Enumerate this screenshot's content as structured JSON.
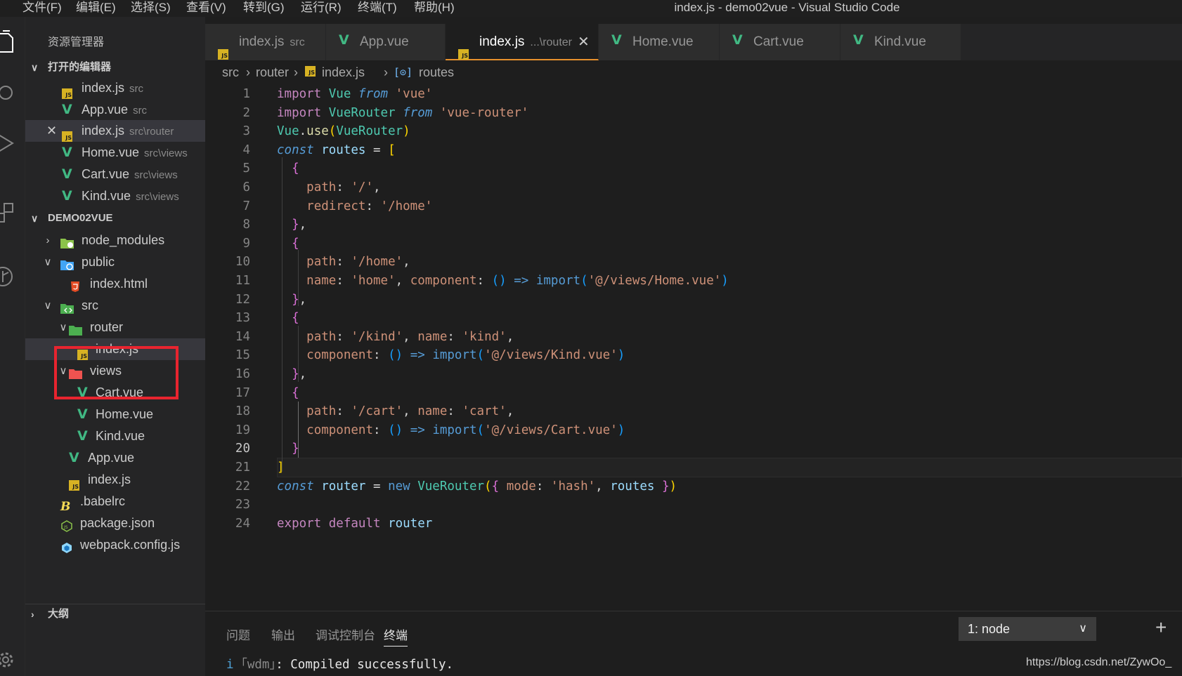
{
  "menubar": {
    "items": [
      "文件(F)",
      "编辑(E)",
      "选择(S)",
      "查看(V)",
      "转到(G)",
      "运行(R)",
      "终端(T)",
      "帮助(H)"
    ],
    "window_title": "index.js - demo02vue - Visual Studio Code"
  },
  "activity_bar": {
    "icons": [
      "files-icon",
      "search-icon",
      "run-debug-icon",
      "extensions-icon",
      "source-control-icon",
      "settings-gear-icon"
    ]
  },
  "sidebar": {
    "title": "资源管理器",
    "open_editors": {
      "header": "打开的编辑器",
      "items": [
        {
          "name": "index.js",
          "desc": "src",
          "icon": "js-file-icon"
        },
        {
          "name": "App.vue",
          "desc": "src",
          "icon": "vue-file-icon"
        },
        {
          "name": "index.js",
          "desc": "src\\router",
          "icon": "js-file-icon",
          "close": "✕"
        },
        {
          "name": "Home.vue",
          "desc": "src\\views",
          "icon": "vue-file-icon"
        },
        {
          "name": "Cart.vue",
          "desc": "src\\views",
          "icon": "vue-file-icon"
        },
        {
          "name": "Kind.vue",
          "desc": "src\\views",
          "icon": "vue-file-icon"
        }
      ]
    },
    "project": {
      "header": "DEMO02VUE",
      "tree": [
        {
          "name": "node_modules",
          "type": "folder",
          "expanded": false
        },
        {
          "name": "public",
          "type": "folder",
          "expanded": true
        },
        {
          "name": "index.html",
          "type": "html"
        },
        {
          "name": "src",
          "type": "folder",
          "expanded": true
        },
        {
          "name": "router",
          "type": "folder",
          "expanded": true
        },
        {
          "name": "index.js",
          "type": "js",
          "selected": true
        },
        {
          "name": "views",
          "type": "folder",
          "expanded": true
        },
        {
          "name": "Cart.vue",
          "type": "vue"
        },
        {
          "name": "Home.vue",
          "type": "vue"
        },
        {
          "name": "Kind.vue",
          "type": "vue"
        },
        {
          "name": "App.vue",
          "type": "vue"
        },
        {
          "name": "index.js",
          "type": "js"
        },
        {
          "name": ".babelrc",
          "type": "babel"
        },
        {
          "name": "package.json",
          "type": "json"
        },
        {
          "name": "webpack.config.js",
          "type": "webpack"
        }
      ]
    },
    "outline": {
      "header": "大纲"
    }
  },
  "tabs": [
    {
      "label": "index.js",
      "desc": "src",
      "icon": "js-file-icon",
      "active": false
    },
    {
      "label": "App.vue",
      "desc": "",
      "icon": "vue-file-icon",
      "active": false
    },
    {
      "label": "index.js",
      "desc": "...\\router",
      "icon": "js-file-icon",
      "active": true,
      "close": "✕"
    },
    {
      "label": "Home.vue",
      "desc": "",
      "icon": "vue-file-icon",
      "active": false
    },
    {
      "label": "Cart.vue",
      "desc": "",
      "icon": "vue-file-icon",
      "active": false
    },
    {
      "label": "Kind.vue",
      "desc": "",
      "icon": "vue-file-icon",
      "active": false
    }
  ],
  "breadcrumb": [
    "src",
    "router",
    "index.js",
    "routes"
  ],
  "editor": {
    "current_line": 20,
    "lines": [
      "import Vue from 'vue'",
      "import VueRouter from 'vue-router'",
      "Vue.use(VueRouter)",
      "const routes = [",
      "  {",
      "    path: '/',",
      "    redirect: '/home'",
      "  },",
      "  {",
      "    path: '/home',",
      "    name: 'home', component: () => import('@/views/Home.vue')",
      "  },",
      "  {",
      "    path: '/kind', name: 'kind',",
      "    component: () => import('@/views/Kind.vue')",
      "  },",
      "  {",
      "    path: '/cart', name: 'cart',",
      "    component: () => import('@/views/Cart.vue')",
      "  }",
      "]",
      "const router = new VueRouter({ mode: 'hash', routes })",
      "",
      "export default router"
    ]
  },
  "panel": {
    "tabs": [
      "问题",
      "输出",
      "调试控制台",
      "终端"
    ],
    "active_tab": "终端",
    "terminal_select": "1: node",
    "add_button": "+",
    "terminal_output": [
      "i",
      "｢wdm｣",
      ": Compiled successfully."
    ]
  },
  "watermark": "https://blog.csdn.net/ZywOo_",
  "colors": {
    "background": "#1e1e1e",
    "sidebar": "#252526",
    "highlight_box": "#e8242f",
    "tab_active_border": "#e8912d"
  }
}
